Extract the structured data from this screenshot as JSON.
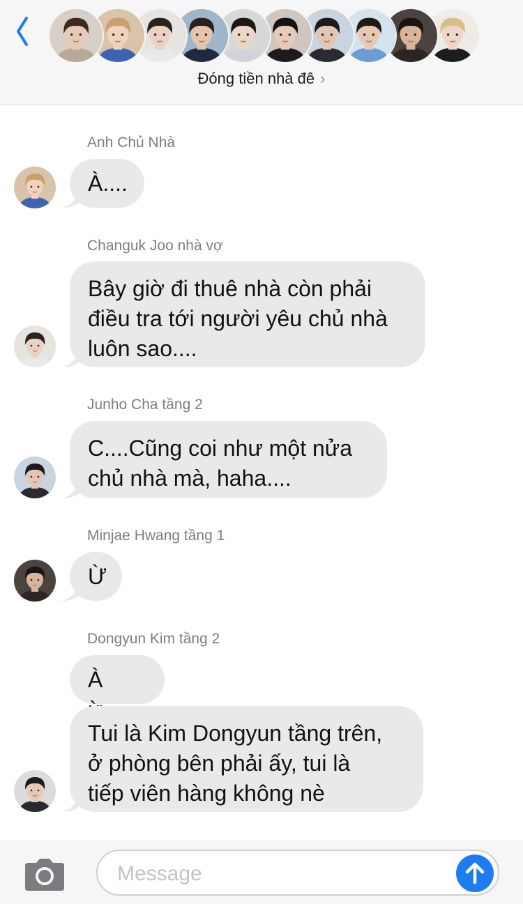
{
  "header": {
    "back_icon": "chevron-left-icon",
    "group_name": "Đóng tiền nhà đê",
    "title_chevron": "›",
    "members": [
      {
        "skin": "#e8c9b4",
        "hair": "#3a2a22",
        "bg": "#d8d0c8",
        "shirt": "#b7a89a"
      },
      {
        "skin": "#f0d2bd",
        "hair": "#c9a06e",
        "bg": "#d9c4aa",
        "shirt": "#3f63b4"
      },
      {
        "skin": "#ecd0c2",
        "hair": "#2b2320",
        "bg": "#e7e3df",
        "shirt": "#e9e9ea"
      },
      {
        "skin": "#e5c4ac",
        "hair": "#2a1f1b",
        "bg": "#9fb6c8",
        "shirt": "#1e2b3f"
      },
      {
        "skin": "#edd6c6",
        "hair": "#1f1715",
        "bg": "#d8d8d8",
        "shirt": "#d2d3d8"
      },
      {
        "skin": "#e7cbb8",
        "hair": "#141212",
        "bg": "#cfc6bf",
        "shirt": "#1b1b1d"
      },
      {
        "skin": "#e4c5b1",
        "hair": "#1c1a1c",
        "bg": "#c9d4e0",
        "shirt": "#2a2a30"
      },
      {
        "skin": "#e6c8b3",
        "hair": "#221a18",
        "bg": "#d5e3ef",
        "shirt": "#6a9cd6"
      },
      {
        "skin": "#d8b49a",
        "hair": "#1a1412",
        "bg": "#4a4340",
        "shirt": "#2c2522"
      },
      {
        "skin": "#eed7c8",
        "hair": "#d8bf8a",
        "bg": "#efece8",
        "shirt": "#1c1c1c"
      }
    ]
  },
  "messages": [
    {
      "sender": "Anh Chủ Nhà",
      "text": [
        "À...."
      ],
      "avatar": {
        "skin": "#f0d2bd",
        "hair": "#c9a06e",
        "bg": "#d9c4aa",
        "shirt": "#3f63b4"
      }
    },
    {
      "sender": "Changuk Joo nhà vợ",
      "text": [
        "Bây giờ đi thuê nhà còn phải",
        "điều tra tới người yêu chủ nhà",
        "luôn sao...."
      ],
      "avatar": {
        "skin": "#ecd0c2",
        "hair": "#2b2320",
        "bg": "#e7e3df",
        "shirt": "#e9e9ea"
      }
    },
    {
      "sender": "Junho Cha tầng 2",
      "text": [
        "C....Cũng coi như một nửa",
        "chủ nhà mà, haha...."
      ],
      "avatar": {
        "skin": "#e4c5b1",
        "hair": "#1c1a1c",
        "bg": "#c9d4e0",
        "shirt": "#2a2a30"
      }
    },
    {
      "sender": "Minjae Hwang tầng 1",
      "text": [
        "Ừ"
      ],
      "avatar": {
        "skin": "#d8b49a",
        "hair": "#1a1412",
        "bg": "#4a4340",
        "shirt": "#2c2522"
      }
    },
    {
      "sender": "Dongyun Kim tầng 2",
      "text": [
        "À ừ...."
      ],
      "avatar": null
    },
    {
      "sender": "",
      "text": [
        "Tui là Kim Dongyun tầng trên,",
        "ở phòng bên phải ấy, tui là",
        "tiếp viên hàng không nè"
      ],
      "avatar": {
        "skin": "#e6c8b3",
        "hair": "#221a18",
        "bg": "#dcdcdc",
        "shirt": "#2a2a2e"
      }
    }
  ],
  "composer": {
    "camera_icon": "camera-icon",
    "placeholder": "Message",
    "send_icon": "arrow-up-icon"
  },
  "colors": {
    "accent": "#1d7cf2",
    "bubble": "#e9e9eb",
    "sender_text": "#7d7d82",
    "header_bg": "#f6f6f6"
  }
}
